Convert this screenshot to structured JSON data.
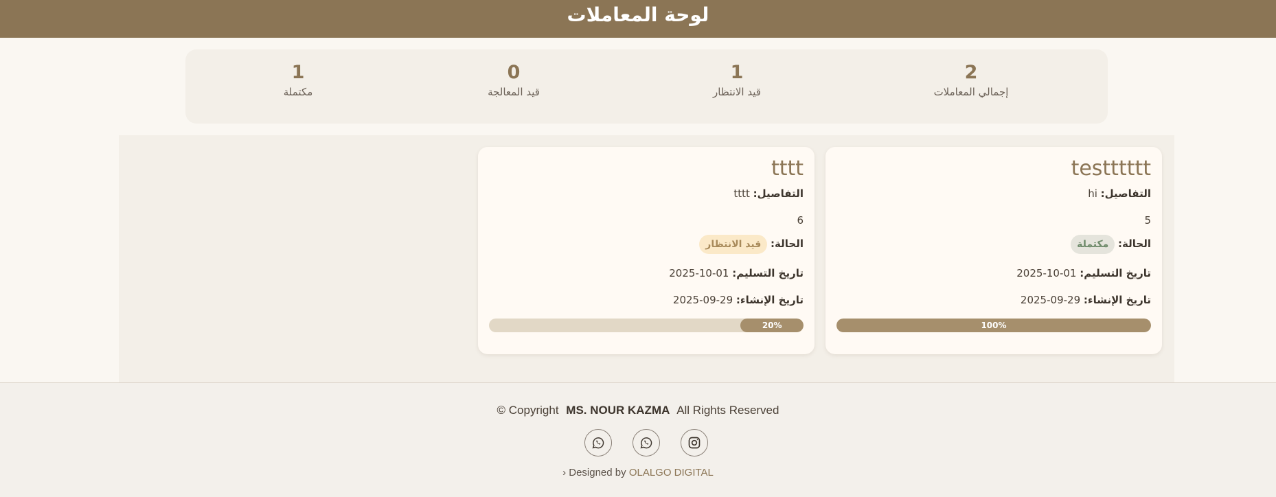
{
  "header": {
    "title": "لوحة المعاملات"
  },
  "stats": [
    {
      "value": "2",
      "label": "إجمالي المعاملات"
    },
    {
      "value": "1",
      "label": "قيد الانتظار"
    },
    {
      "value": "0",
      "label": "قيد المعالجة"
    },
    {
      "value": "1",
      "label": "مكتملة"
    }
  ],
  "cards": [
    {
      "title": "testttttt",
      "details_label": "التفاصيل:",
      "details_value": "hi",
      "number": "5",
      "status_label": "الحالة:",
      "status_value": "مكتملة",
      "delivery_label": "تاريخ التسليم:",
      "delivery_value": "01-10-2025",
      "created_label": "تاريخ الإنشاء:",
      "created_value": "29-09-2025",
      "progress_text": "100%",
      "progress": 100
    },
    {
      "title": "tttt",
      "details_label": "التفاصيل:",
      "details_value": "tttt",
      "number": "6",
      "status_label": "الحالة:",
      "status_value": "قيد الانتظار",
      "delivery_label": "تاريخ التسليم:",
      "delivery_value": "01-10-2025",
      "created_label": "تاريخ الإنشاء:",
      "created_value": "29-09-2025",
      "progress_text": "20%",
      "progress": 20
    }
  ],
  "footer": {
    "copyright_prefix": "© Copyright",
    "brand": "MS. NOUR KAZMA",
    "rights": "All Rights Reserved",
    "designed_prefix": "› Designed by",
    "designed_company": "OLALGO DIGITAL",
    "socials": [
      "whatsapp-icon",
      "whatsapp-icon",
      "instagram-icon"
    ]
  },
  "colors": {
    "header": "#8b7555",
    "accent": "#a68f6c",
    "status_done_bg": "#e5e4dc",
    "status_wait_bg": "#fbe9c8"
  }
}
